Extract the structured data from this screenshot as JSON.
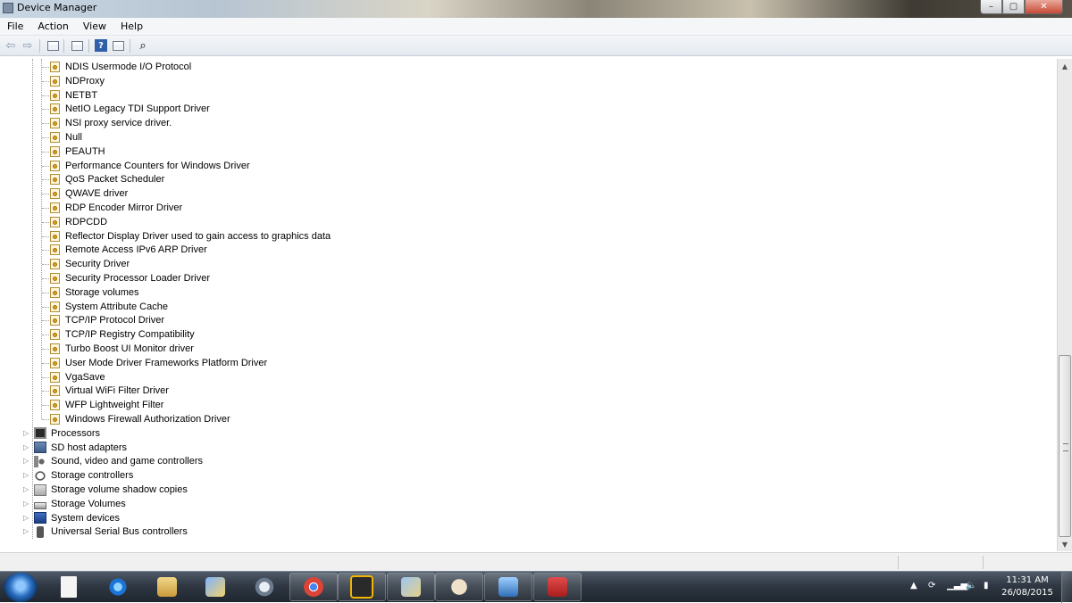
{
  "window": {
    "title": "Device Manager",
    "controls": [
      "minimize",
      "maximize",
      "close"
    ]
  },
  "menu": {
    "items": [
      "File",
      "Action",
      "View",
      "Help"
    ]
  },
  "toolbar": {
    "icons": [
      "back-arrow-icon",
      "forward-arrow-icon",
      "console-tree-icon",
      "properties-icon",
      "help-icon",
      "view-icon",
      "scan-hardware-icon"
    ]
  },
  "tree": {
    "drivers": [
      "NDIS Usermode I/O Protocol",
      "NDProxy",
      "NETBT",
      "NetIO Legacy TDI Support Driver",
      "NSI proxy service driver.",
      "Null",
      "PEAUTH",
      "Performance Counters for Windows Driver",
      "QoS Packet Scheduler",
      "QWAVE driver",
      "RDP Encoder Mirror Driver",
      "RDPCDD",
      "Reflector Display Driver used to gain access to graphics data",
      "Remote Access IPv6 ARP Driver",
      "Security Driver",
      "Security Processor Loader Driver",
      "Storage volumes",
      "System Attribute Cache",
      "TCP/IP Protocol Driver",
      "TCP/IP Registry Compatibility",
      "Turbo Boost UI Monitor driver",
      "User Mode Driver Frameworks Platform Driver",
      "VgaSave",
      "Virtual WiFi Filter Driver",
      "WFP Lightweight Filter",
      "Windows Firewall Authorization Driver"
    ],
    "categories": [
      {
        "label": "Processors",
        "icon": "processor-icon"
      },
      {
        "label": "SD host adapters",
        "icon": "sd-host-adapter-icon"
      },
      {
        "label": "Sound, video and game controllers",
        "icon": "speaker-icon"
      },
      {
        "label": "Storage controllers",
        "icon": "storage-controller-icon"
      },
      {
        "label": "Storage volume shadow copies",
        "icon": "shadow-copy-icon"
      },
      {
        "label": "Storage Volumes",
        "icon": "storage-volume-icon"
      },
      {
        "label": "System devices",
        "icon": "system-device-icon"
      },
      {
        "label": "Universal Serial Bus controllers",
        "icon": "usb-icon"
      }
    ]
  },
  "taskbar": {
    "apps": [
      "new-document-icon",
      "internet-explorer-icon",
      "file-explorer-icon",
      "paint-icon",
      "media-player-icon",
      "chrome-icon",
      "video-player-icon",
      "photo-viewer-icon",
      "paint-palette-icon",
      "remote-desktop-icon",
      "device-manager-icon"
    ],
    "clock": {
      "time": "11:31 AM",
      "date": "26/08/2015"
    }
  },
  "colors": {
    "taskbar_top": "#4f5a68",
    "taskbar_bottom": "#1f262f",
    "menu_bg": "#f5f6f7",
    "tree_lines": "#a0a0a0"
  }
}
